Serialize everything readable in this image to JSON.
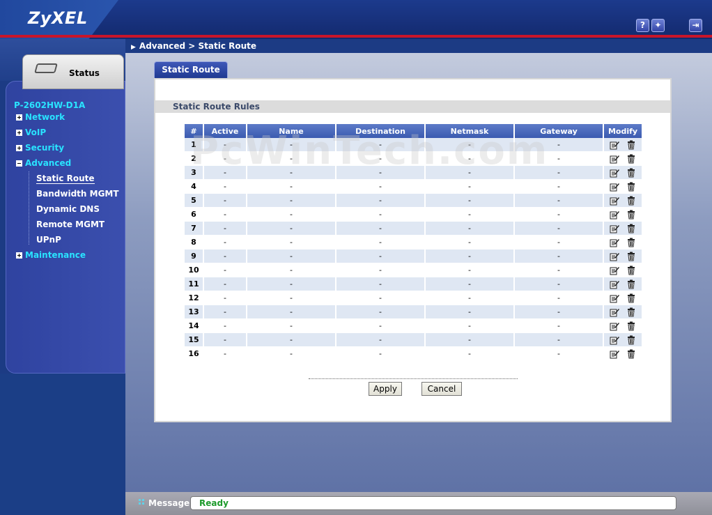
{
  "header": {
    "logo": "ZyXEL",
    "icons": [
      {
        "name": "help-icon",
        "glyph": "?"
      },
      {
        "name": "wizard-icon",
        "glyph": "✦"
      },
      {
        "name": "logout-icon",
        "glyph": "⇥"
      }
    ]
  },
  "sidebar": {
    "status_tab_label": "Status",
    "model": "P-2602HW-D1A",
    "items": [
      {
        "label": "Network",
        "expanded": false
      },
      {
        "label": "VoIP",
        "expanded": false
      },
      {
        "label": "Security",
        "expanded": false
      },
      {
        "label": "Advanced",
        "expanded": true
      },
      {
        "label": "Maintenance",
        "expanded": false
      }
    ],
    "subitems": [
      "Static Route",
      "Bandwidth MGMT",
      "Dynamic DNS",
      "Remote MGMT",
      "UPnP"
    ],
    "active_subitem": "Static Route"
  },
  "breadcrumb": "Advanced > Static Route",
  "page_tab": "Static Route",
  "section_title": "Static Route Rules",
  "table": {
    "headers": [
      "#",
      "Active",
      "Name",
      "Destination",
      "Netmask",
      "Gateway",
      "Modify"
    ],
    "rows": [
      [
        "1",
        "-",
        "-",
        "-",
        "-",
        "-"
      ],
      [
        "2",
        "-",
        "-",
        "-",
        "-",
        "-"
      ],
      [
        "3",
        "-",
        "-",
        "-",
        "-",
        "-"
      ],
      [
        "4",
        "-",
        "-",
        "-",
        "-",
        "-"
      ],
      [
        "5",
        "-",
        "-",
        "-",
        "-",
        "-"
      ],
      [
        "6",
        "-",
        "-",
        "-",
        "-",
        "-"
      ],
      [
        "7",
        "-",
        "-",
        "-",
        "-",
        "-"
      ],
      [
        "8",
        "-",
        "-",
        "-",
        "-",
        "-"
      ],
      [
        "9",
        "-",
        "-",
        "-",
        "-",
        "-"
      ],
      [
        "10",
        "-",
        "-",
        "-",
        "-",
        "-"
      ],
      [
        "11",
        "-",
        "-",
        "-",
        "-",
        "-"
      ],
      [
        "12",
        "-",
        "-",
        "-",
        "-",
        "-"
      ],
      [
        "13",
        "-",
        "-",
        "-",
        "-",
        "-"
      ],
      [
        "14",
        "-",
        "-",
        "-",
        "-",
        "-"
      ],
      [
        "15",
        "-",
        "-",
        "-",
        "-",
        "-"
      ],
      [
        "16",
        "-",
        "-",
        "-",
        "-",
        "-"
      ]
    ]
  },
  "buttons": {
    "apply": "Apply",
    "cancel": "Cancel"
  },
  "watermark": "PcWinTech.com",
  "statusbar": {
    "label": "Message",
    "message": "Ready"
  },
  "colors": {
    "header_blue": "#1c3a8c",
    "accent_red": "#c8152a",
    "menu_cyan": "#29e3ff",
    "status_green": "#1d9a2b"
  }
}
